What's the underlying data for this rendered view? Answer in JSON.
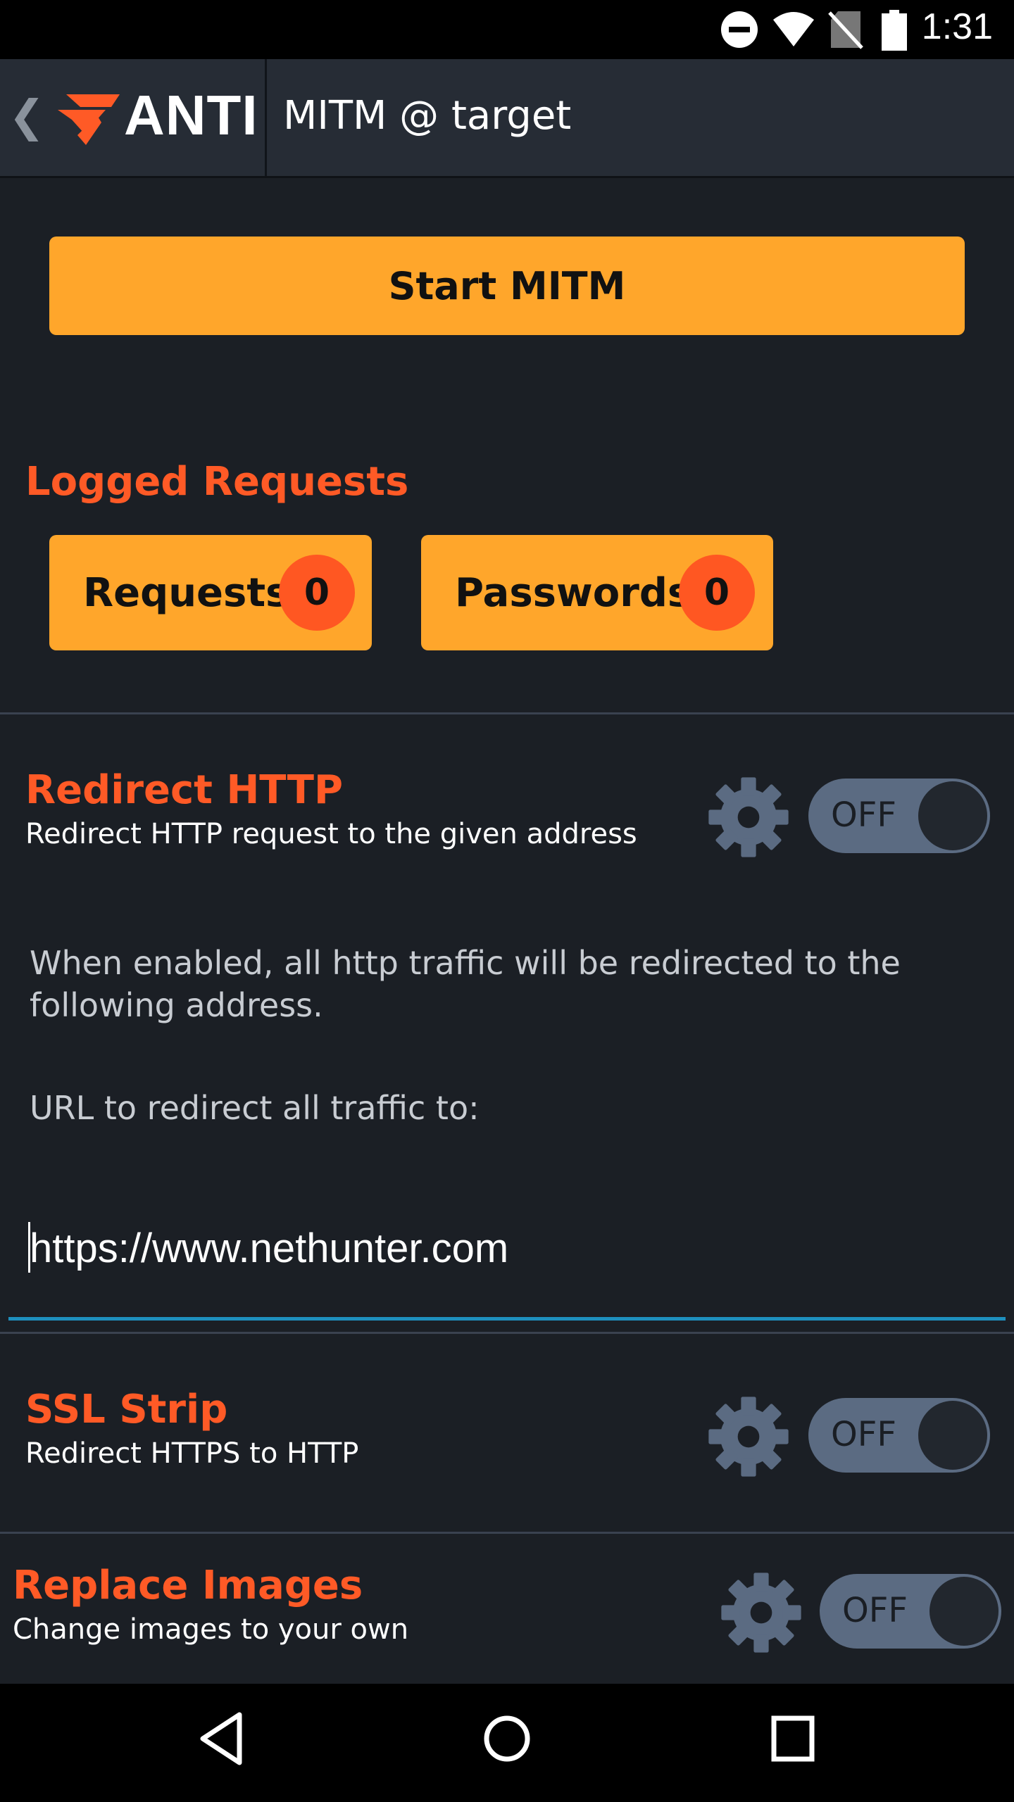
{
  "status_bar": {
    "time": "1:31",
    "icons": [
      "do-not-disturb-icon",
      "wifi-icon",
      "no-sim-icon",
      "battery-icon"
    ]
  },
  "app_bar": {
    "logo_text": "ANTI",
    "title": "MITM @ target"
  },
  "start_button": {
    "label": "Start MITM"
  },
  "logged_requests": {
    "title": "Logged Requests",
    "requests": {
      "label": "Requests",
      "count": "0"
    },
    "passwords": {
      "label": "Passwords",
      "count": "0"
    }
  },
  "redirect_http": {
    "title": "Redirect HTTP",
    "subtitle": "Redirect HTTP request to the given address",
    "toggle": "OFF",
    "description": "When enabled, all http traffic will be redirected to the following address.",
    "url_label": "URL to redirect all traffic to:",
    "url_value": "https://www.nethunter.com"
  },
  "ssl_strip": {
    "title": "SSL Strip",
    "subtitle": "Redirect HTTPS to HTTP",
    "toggle": "OFF"
  },
  "replace_images": {
    "title": "Replace Images",
    "subtitle": "Change images to your own",
    "toggle": "OFF"
  },
  "colors": {
    "background": "#1b1f25",
    "accent_orange": "#ffa62b",
    "title_orange": "#ff5a26",
    "badge": "#ff5722",
    "toggle_off": "#5b6b82",
    "input_underline": "#1e8fbe"
  }
}
